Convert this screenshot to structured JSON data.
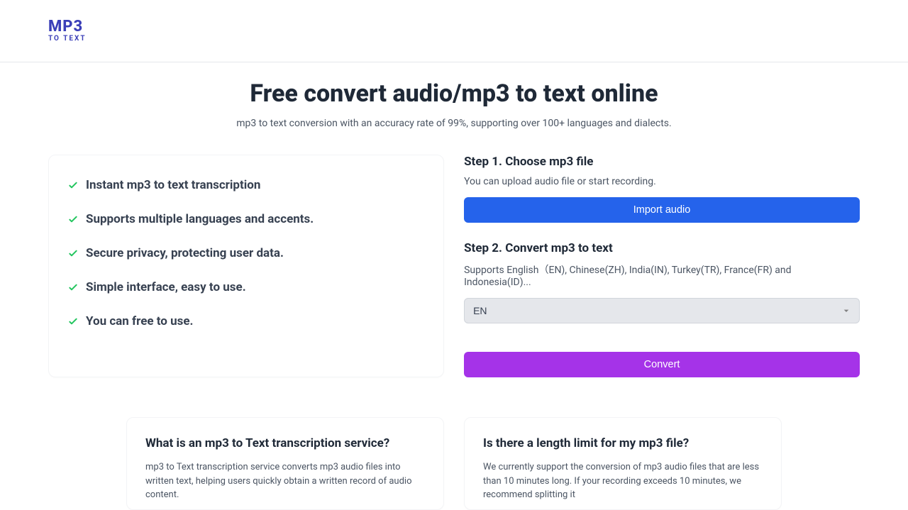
{
  "logo": {
    "top": "MP3",
    "bottom": "TO TEXT"
  },
  "hero": {
    "title": "Free convert audio/mp3 to text online",
    "subtitle": "mp3 to text conversion with an accuracy rate of 99%, supporting over 100+ languages and dialects."
  },
  "features": [
    "Instant mp3 to text transcription",
    "Supports multiple languages and accents.",
    "Secure privacy, protecting user data.",
    "Simple interface, easy to use.",
    "You can free to use."
  ],
  "step1": {
    "title": "Step 1. Choose mp3 file",
    "desc": "You can upload audio file or start recording.",
    "button": "Import audio"
  },
  "step2": {
    "title": "Step 2. Convert mp3 to text",
    "desc": "Supports English（EN), Chinese(ZH), India(IN), Turkey(TR), France(FR) and Indonesia(ID)...",
    "selected_language": "EN"
  },
  "convert_button": "Convert",
  "faq": [
    {
      "question": "What is an mp3 to Text transcription service?",
      "answer": "mp3 to Text transcription service converts mp3 audio files into written text, helping users quickly obtain a written record of audio content."
    },
    {
      "question": "Is there a length limit for my mp3 file?",
      "answer": "We currently support the conversion of mp3 audio files that are less than 10 minutes long. If your recording exceeds 10 minutes, we recommend splitting it"
    }
  ]
}
